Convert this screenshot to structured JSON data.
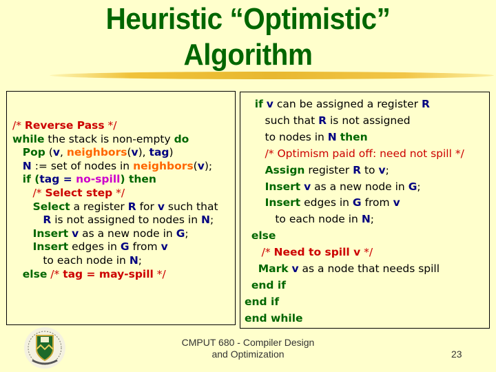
{
  "slide": {
    "title_line1": "Heuristic “Optimistic”",
    "title_line2": "Algorithm",
    "footer_line1": "CMPUT 680 - Compiler Design",
    "footer_line2": "and Optimization",
    "page_number": "23",
    "logo": "university-crest-icon"
  },
  "left_code": [
    [
      {
        "t": "/* ",
        "c": "cm"
      },
      {
        "t": "Reverse Pass",
        "c": "cmb"
      },
      {
        "t": " */",
        "c": "cm"
      }
    ],
    [
      {
        "t": "while",
        "c": "kw"
      },
      {
        "t": " the stack is non-empty ",
        "c": ""
      },
      {
        "t": "do",
        "c": "kw"
      }
    ],
    [
      {
        "t": "   ",
        "c": ""
      },
      {
        "t": "Pop",
        "c": "kw"
      },
      {
        "t": " (",
        "c": ""
      },
      {
        "t": "v",
        "c": "var"
      },
      {
        "t": ", ",
        "c": ""
      },
      {
        "t": "neighbors",
        "c": "fn"
      },
      {
        "t": "(",
        "c": ""
      },
      {
        "t": "v",
        "c": "var"
      },
      {
        "t": "), ",
        "c": ""
      },
      {
        "t": "tag",
        "c": "var"
      },
      {
        "t": ")",
        "c": ""
      }
    ],
    [
      {
        "t": "   ",
        "c": ""
      },
      {
        "t": "N",
        "c": "var"
      },
      {
        "t": " := set of nodes in ",
        "c": ""
      },
      {
        "t": "neighbors",
        "c": "fn"
      },
      {
        "t": "(",
        "c": ""
      },
      {
        "t": "v",
        "c": "var"
      },
      {
        "t": ");",
        "c": ""
      }
    ],
    [
      {
        "t": "   ",
        "c": ""
      },
      {
        "t": "if (",
        "c": "kw"
      },
      {
        "t": "tag",
        "c": "var"
      },
      {
        "t": " = ",
        "c": "var"
      },
      {
        "t": "no-spill",
        "c": "mg"
      },
      {
        "t": ") then",
        "c": "kw"
      }
    ],
    [
      {
        "t": "      /* ",
        "c": "cm"
      },
      {
        "t": "Select step",
        "c": "cmb"
      },
      {
        "t": " */",
        "c": "cm"
      }
    ],
    [
      {
        "t": "      ",
        "c": ""
      },
      {
        "t": "Select",
        "c": "kw"
      },
      {
        "t": " a register ",
        "c": ""
      },
      {
        "t": "R",
        "c": "var"
      },
      {
        "t": " for ",
        "c": ""
      },
      {
        "t": "v",
        "c": "var"
      },
      {
        "t": " such that",
        "c": ""
      }
    ],
    [
      {
        "t": "         ",
        "c": ""
      },
      {
        "t": "R",
        "c": "var"
      },
      {
        "t": " is not assigned to nodes in ",
        "c": ""
      },
      {
        "t": "N",
        "c": "var"
      },
      {
        "t": ";",
        "c": ""
      }
    ],
    [
      {
        "t": "      ",
        "c": ""
      },
      {
        "t": "Insert",
        "c": "kw"
      },
      {
        "t": " ",
        "c": ""
      },
      {
        "t": "v",
        "c": "var"
      },
      {
        "t": " as a new node in ",
        "c": ""
      },
      {
        "t": "G",
        "c": "var"
      },
      {
        "t": ";",
        "c": ""
      }
    ],
    [
      {
        "t": "      ",
        "c": ""
      },
      {
        "t": "Insert",
        "c": "kw"
      },
      {
        "t": " edges in ",
        "c": ""
      },
      {
        "t": "G",
        "c": "var"
      },
      {
        "t": " from ",
        "c": ""
      },
      {
        "t": "v",
        "c": "var"
      }
    ],
    [
      {
        "t": "         to each node in ",
        "c": ""
      },
      {
        "t": "N",
        "c": "var"
      },
      {
        "t": ";",
        "c": ""
      }
    ],
    [
      {
        "t": "   ",
        "c": ""
      },
      {
        "t": "else",
        "c": "kw"
      },
      {
        "t": " /* ",
        "c": "cm"
      },
      {
        "t": "tag = may-spill",
        "c": "cmb"
      },
      {
        "t": " */",
        "c": "cm"
      }
    ]
  ],
  "right_code": [
    [
      {
        "t": "   ",
        "c": ""
      },
      {
        "t": "if",
        "c": "kw"
      },
      {
        "t": " ",
        "c": ""
      },
      {
        "t": "v",
        "c": "var"
      },
      {
        "t": " can be assigned a register ",
        "c": ""
      },
      {
        "t": "R",
        "c": "var"
      }
    ],
    [
      {
        "t": "      such that ",
        "c": ""
      },
      {
        "t": "R",
        "c": "var"
      },
      {
        "t": " is not assigned",
        "c": ""
      }
    ],
    [
      {
        "t": "      to nodes in ",
        "c": ""
      },
      {
        "t": "N",
        "c": "var"
      },
      {
        "t": " ",
        "c": ""
      },
      {
        "t": "then",
        "c": "kw"
      }
    ],
    [
      {
        "t": "      /* Optimism paid off: need not spill */",
        "c": "cm"
      }
    ],
    [
      {
        "t": "      ",
        "c": ""
      },
      {
        "t": "Assign",
        "c": "kw"
      },
      {
        "t": " register ",
        "c": ""
      },
      {
        "t": "R",
        "c": "var"
      },
      {
        "t": " to ",
        "c": ""
      },
      {
        "t": "v",
        "c": "var"
      },
      {
        "t": ";",
        "c": ""
      }
    ],
    [
      {
        "t": "      ",
        "c": ""
      },
      {
        "t": "Insert",
        "c": "kw"
      },
      {
        "t": " ",
        "c": ""
      },
      {
        "t": "v",
        "c": "var"
      },
      {
        "t": " as a new node in ",
        "c": ""
      },
      {
        "t": "G",
        "c": "var"
      },
      {
        "t": ";",
        "c": ""
      }
    ],
    [
      {
        "t": "      ",
        "c": ""
      },
      {
        "t": "Insert",
        "c": "kw"
      },
      {
        "t": " edges in ",
        "c": ""
      },
      {
        "t": "G",
        "c": "var"
      },
      {
        "t": " from ",
        "c": ""
      },
      {
        "t": "v",
        "c": "var"
      }
    ],
    [
      {
        "t": "         to each node in ",
        "c": ""
      },
      {
        "t": "N",
        "c": "var"
      },
      {
        "t": ";",
        "c": ""
      }
    ],
    [
      {
        "t": "  ",
        "c": ""
      },
      {
        "t": "else",
        "c": "kw"
      }
    ],
    [
      {
        "t": "     /* ",
        "c": "cm"
      },
      {
        "t": "Need to spill v",
        "c": "cmb"
      },
      {
        "t": " */",
        "c": "cm"
      }
    ],
    [
      {
        "t": "    ",
        "c": ""
      },
      {
        "t": "Mark",
        "c": "kw"
      },
      {
        "t": " ",
        "c": ""
      },
      {
        "t": "v",
        "c": "var"
      },
      {
        "t": " as a node that needs spill",
        "c": ""
      }
    ],
    [
      {
        "t": "  ",
        "c": ""
      },
      {
        "t": "end if",
        "c": "kw"
      }
    ],
    [
      {
        "t": "end if",
        "c": "kw"
      }
    ],
    [
      {
        "t": "end while",
        "c": "kw"
      }
    ]
  ]
}
